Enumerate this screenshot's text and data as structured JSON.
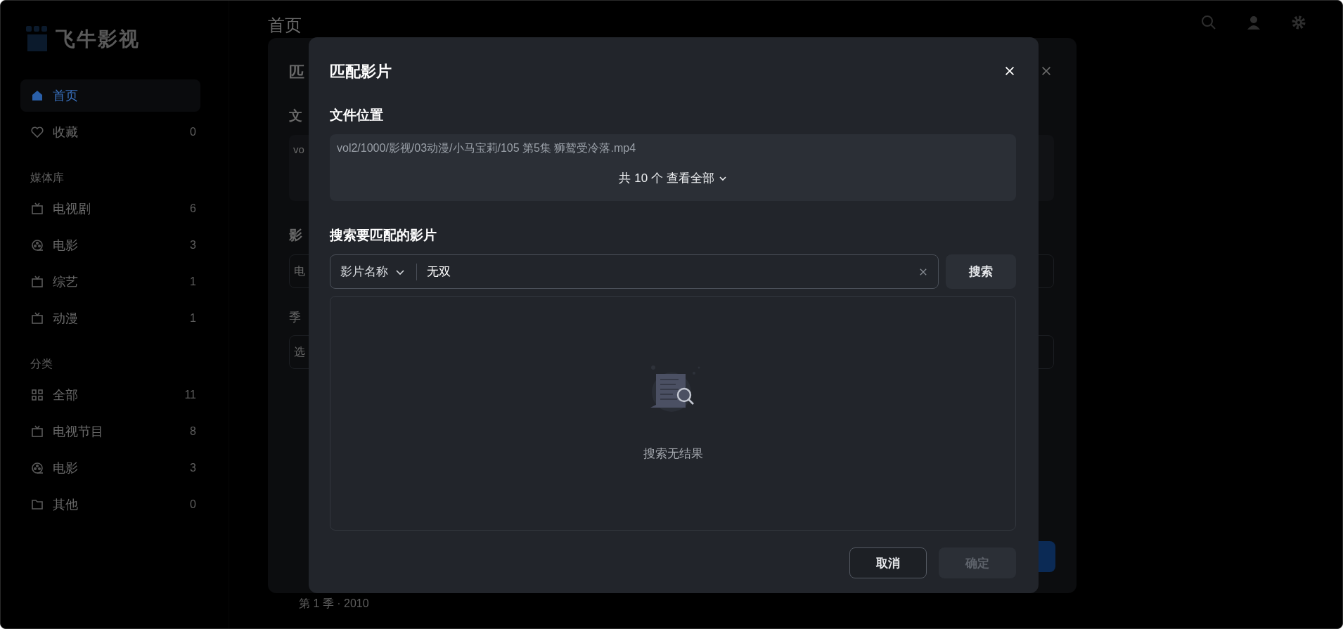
{
  "sidebar": {
    "logo": "飞牛影视",
    "items": [
      {
        "label": "首页",
        "kind": "home",
        "selected": true
      },
      {
        "label": "收藏",
        "kind": "favorites",
        "count": "0",
        "selected": false
      }
    ],
    "sections": [
      {
        "title": "媒体库",
        "items": [
          {
            "label": "电视剧",
            "kind": "tv",
            "count": "6",
            "selected": false
          },
          {
            "label": "电影",
            "kind": "movie",
            "count": "3",
            "selected": false
          },
          {
            "label": "综艺",
            "kind": "tv",
            "count": "1",
            "selected": false
          },
          {
            "label": "动漫",
            "kind": "tv",
            "count": "1",
            "selected": false
          }
        ]
      },
      {
        "title": "分类",
        "items": [
          {
            "label": "全部",
            "kind": "all",
            "count": "11",
            "selected": false
          },
          {
            "label": "电视节目",
            "kind": "tv",
            "count": "8",
            "selected": false
          },
          {
            "label": "电影",
            "kind": "movie",
            "count": "3",
            "selected": false
          },
          {
            "label": "其他",
            "kind": "other",
            "count": "0",
            "selected": false
          }
        ]
      }
    ]
  },
  "header": {
    "title": "首页"
  },
  "background_dialog": {
    "title": "匹",
    "section_1": "文",
    "path": "vo",
    "section_2": "影",
    "field_1": "电",
    "section_3": "季",
    "field_2": "选",
    "footer_text": "第 1 季 · 2010"
  },
  "dialog": {
    "title": "匹配影片",
    "file_section": {
      "label": "文件位置",
      "path": "vol2/1000/影视/03动漫/小马宝莉/105 第5集 狮鹫受冷落.mp4",
      "more": "共 10 个 查看全部"
    },
    "search_section": {
      "label": "搜索要匹配的影片",
      "field_type": "影片名称",
      "value": "无双",
      "button": "搜索"
    },
    "empty": {
      "message": "搜索无结果"
    },
    "buttons": [
      {
        "label": "取消",
        "kind": "secondary",
        "disabled": false
      },
      {
        "label": "确定",
        "kind": "primary",
        "disabled": true
      }
    ]
  }
}
